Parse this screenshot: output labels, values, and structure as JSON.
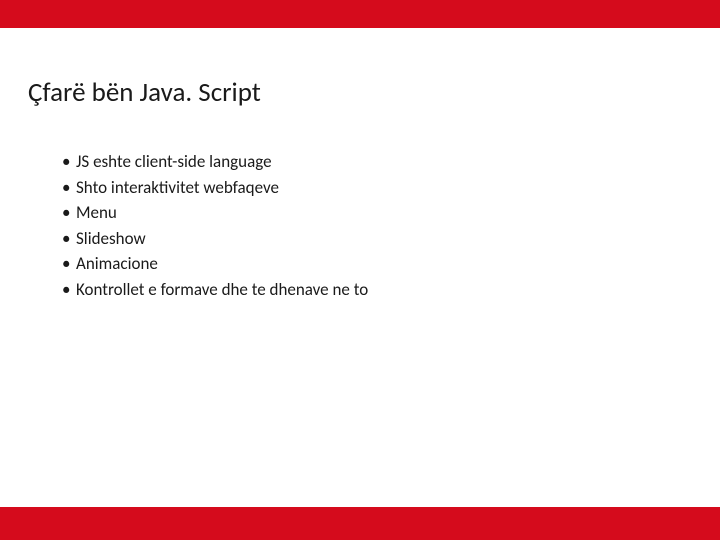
{
  "colors": {
    "accent": "#d50b1c",
    "text": "#1a1a1a",
    "background": "#ffffff"
  },
  "slide": {
    "title": "Çfarë bën Java. Script",
    "bullets": [
      "JS eshte client-side language",
      "Shto interaktivitet webfaqeve",
      "Menu",
      "Slideshow",
      "Animacione",
      "Kontrollet e formave dhe te dhenave ne to"
    ]
  }
}
